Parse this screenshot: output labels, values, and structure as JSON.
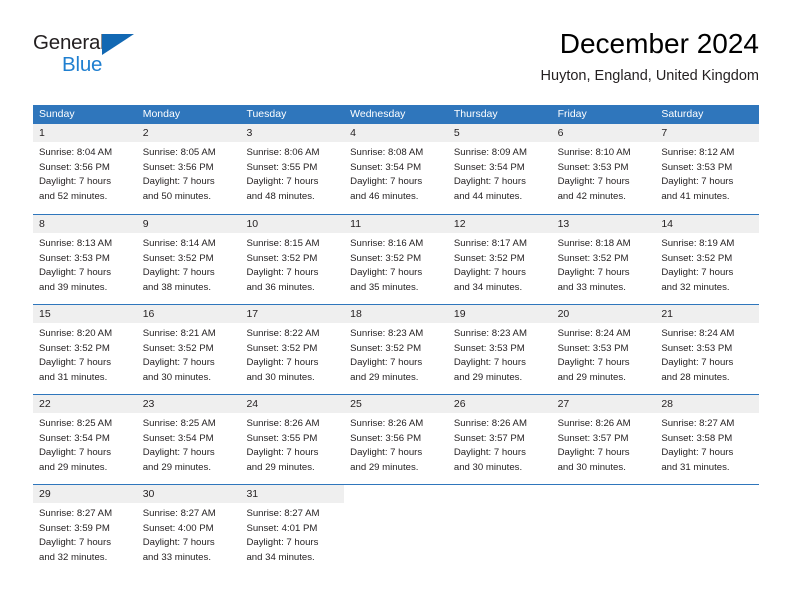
{
  "brand": {
    "name_part1": "General",
    "name_part2": "Blue",
    "triangle_color": "#1268b3",
    "blue_color": "#1f7fd0"
  },
  "header": {
    "title": "December 2024",
    "subtitle": "Huyton, England, United Kingdom"
  },
  "theme": {
    "header_blue": "#2f76bc",
    "dateband_gray": "#efefef",
    "text": "#231f20"
  },
  "weekday_headers": [
    "Sunday",
    "Monday",
    "Tuesday",
    "Wednesday",
    "Thursday",
    "Friday",
    "Saturday"
  ],
  "weeks": [
    [
      {
        "date": "1",
        "sunrise": "Sunrise: 8:04 AM",
        "sunset": "Sunset: 3:56 PM",
        "daylight1": "Daylight: 7 hours",
        "daylight2": "and 52 minutes."
      },
      {
        "date": "2",
        "sunrise": "Sunrise: 8:05 AM",
        "sunset": "Sunset: 3:56 PM",
        "daylight1": "Daylight: 7 hours",
        "daylight2": "and 50 minutes."
      },
      {
        "date": "3",
        "sunrise": "Sunrise: 8:06 AM",
        "sunset": "Sunset: 3:55 PM",
        "daylight1": "Daylight: 7 hours",
        "daylight2": "and 48 minutes."
      },
      {
        "date": "4",
        "sunrise": "Sunrise: 8:08 AM",
        "sunset": "Sunset: 3:54 PM",
        "daylight1": "Daylight: 7 hours",
        "daylight2": "and 46 minutes."
      },
      {
        "date": "5",
        "sunrise": "Sunrise: 8:09 AM",
        "sunset": "Sunset: 3:54 PM",
        "daylight1": "Daylight: 7 hours",
        "daylight2": "and 44 minutes."
      },
      {
        "date": "6",
        "sunrise": "Sunrise: 8:10 AM",
        "sunset": "Sunset: 3:53 PM",
        "daylight1": "Daylight: 7 hours",
        "daylight2": "and 42 minutes."
      },
      {
        "date": "7",
        "sunrise": "Sunrise: 8:12 AM",
        "sunset": "Sunset: 3:53 PM",
        "daylight1": "Daylight: 7 hours",
        "daylight2": "and 41 minutes."
      }
    ],
    [
      {
        "date": "8",
        "sunrise": "Sunrise: 8:13 AM",
        "sunset": "Sunset: 3:53 PM",
        "daylight1": "Daylight: 7 hours",
        "daylight2": "and 39 minutes."
      },
      {
        "date": "9",
        "sunrise": "Sunrise: 8:14 AM",
        "sunset": "Sunset: 3:52 PM",
        "daylight1": "Daylight: 7 hours",
        "daylight2": "and 38 minutes."
      },
      {
        "date": "10",
        "sunrise": "Sunrise: 8:15 AM",
        "sunset": "Sunset: 3:52 PM",
        "daylight1": "Daylight: 7 hours",
        "daylight2": "and 36 minutes."
      },
      {
        "date": "11",
        "sunrise": "Sunrise: 8:16 AM",
        "sunset": "Sunset: 3:52 PM",
        "daylight1": "Daylight: 7 hours",
        "daylight2": "and 35 minutes."
      },
      {
        "date": "12",
        "sunrise": "Sunrise: 8:17 AM",
        "sunset": "Sunset: 3:52 PM",
        "daylight1": "Daylight: 7 hours",
        "daylight2": "and 34 minutes."
      },
      {
        "date": "13",
        "sunrise": "Sunrise: 8:18 AM",
        "sunset": "Sunset: 3:52 PM",
        "daylight1": "Daylight: 7 hours",
        "daylight2": "and 33 minutes."
      },
      {
        "date": "14",
        "sunrise": "Sunrise: 8:19 AM",
        "sunset": "Sunset: 3:52 PM",
        "daylight1": "Daylight: 7 hours",
        "daylight2": "and 32 minutes."
      }
    ],
    [
      {
        "date": "15",
        "sunrise": "Sunrise: 8:20 AM",
        "sunset": "Sunset: 3:52 PM",
        "daylight1": "Daylight: 7 hours",
        "daylight2": "and 31 minutes."
      },
      {
        "date": "16",
        "sunrise": "Sunrise: 8:21 AM",
        "sunset": "Sunset: 3:52 PM",
        "daylight1": "Daylight: 7 hours",
        "daylight2": "and 30 minutes."
      },
      {
        "date": "17",
        "sunrise": "Sunrise: 8:22 AM",
        "sunset": "Sunset: 3:52 PM",
        "daylight1": "Daylight: 7 hours",
        "daylight2": "and 30 minutes."
      },
      {
        "date": "18",
        "sunrise": "Sunrise: 8:23 AM",
        "sunset": "Sunset: 3:52 PM",
        "daylight1": "Daylight: 7 hours",
        "daylight2": "and 29 minutes."
      },
      {
        "date": "19",
        "sunrise": "Sunrise: 8:23 AM",
        "sunset": "Sunset: 3:53 PM",
        "daylight1": "Daylight: 7 hours",
        "daylight2": "and 29 minutes."
      },
      {
        "date": "20",
        "sunrise": "Sunrise: 8:24 AM",
        "sunset": "Sunset: 3:53 PM",
        "daylight1": "Daylight: 7 hours",
        "daylight2": "and 29 minutes."
      },
      {
        "date": "21",
        "sunrise": "Sunrise: 8:24 AM",
        "sunset": "Sunset: 3:53 PM",
        "daylight1": "Daylight: 7 hours",
        "daylight2": "and 28 minutes."
      }
    ],
    [
      {
        "date": "22",
        "sunrise": "Sunrise: 8:25 AM",
        "sunset": "Sunset: 3:54 PM",
        "daylight1": "Daylight: 7 hours",
        "daylight2": "and 29 minutes."
      },
      {
        "date": "23",
        "sunrise": "Sunrise: 8:25 AM",
        "sunset": "Sunset: 3:54 PM",
        "daylight1": "Daylight: 7 hours",
        "daylight2": "and 29 minutes."
      },
      {
        "date": "24",
        "sunrise": "Sunrise: 8:26 AM",
        "sunset": "Sunset: 3:55 PM",
        "daylight1": "Daylight: 7 hours",
        "daylight2": "and 29 minutes."
      },
      {
        "date": "25",
        "sunrise": "Sunrise: 8:26 AM",
        "sunset": "Sunset: 3:56 PM",
        "daylight1": "Daylight: 7 hours",
        "daylight2": "and 29 minutes."
      },
      {
        "date": "26",
        "sunrise": "Sunrise: 8:26 AM",
        "sunset": "Sunset: 3:57 PM",
        "daylight1": "Daylight: 7 hours",
        "daylight2": "and 30 minutes."
      },
      {
        "date": "27",
        "sunrise": "Sunrise: 8:26 AM",
        "sunset": "Sunset: 3:57 PM",
        "daylight1": "Daylight: 7 hours",
        "daylight2": "and 30 minutes."
      },
      {
        "date": "28",
        "sunrise": "Sunrise: 8:27 AM",
        "sunset": "Sunset: 3:58 PM",
        "daylight1": "Daylight: 7 hours",
        "daylight2": "and 31 minutes."
      }
    ],
    [
      {
        "date": "29",
        "sunrise": "Sunrise: 8:27 AM",
        "sunset": "Sunset: 3:59 PM",
        "daylight1": "Daylight: 7 hours",
        "daylight2": "and 32 minutes."
      },
      {
        "date": "30",
        "sunrise": "Sunrise: 8:27 AM",
        "sunset": "Sunset: 4:00 PM",
        "daylight1": "Daylight: 7 hours",
        "daylight2": "and 33 minutes."
      },
      {
        "date": "31",
        "sunrise": "Sunrise: 8:27 AM",
        "sunset": "Sunset: 4:01 PM",
        "daylight1": "Daylight: 7 hours",
        "daylight2": "and 34 minutes."
      },
      {
        "date": "",
        "sunrise": "",
        "sunset": "",
        "daylight1": "",
        "daylight2": ""
      },
      {
        "date": "",
        "sunrise": "",
        "sunset": "",
        "daylight1": "",
        "daylight2": ""
      },
      {
        "date": "",
        "sunrise": "",
        "sunset": "",
        "daylight1": "",
        "daylight2": ""
      },
      {
        "date": "",
        "sunrise": "",
        "sunset": "",
        "daylight1": "",
        "daylight2": ""
      }
    ]
  ]
}
